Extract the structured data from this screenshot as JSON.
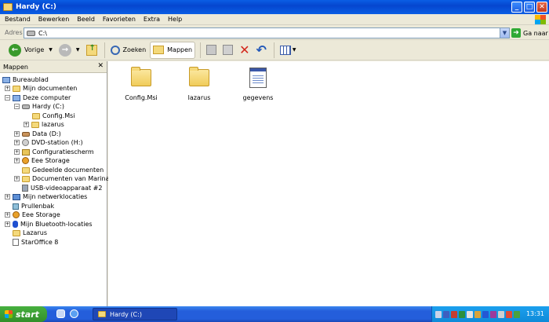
{
  "window": {
    "title": "Hardy (C:)",
    "controls": {
      "minimize": "_",
      "maximize": "□",
      "close": "✕"
    }
  },
  "menu": [
    "Bestand",
    "Bewerken",
    "Beeld",
    "Favorieten",
    "Extra",
    "Help"
  ],
  "address": {
    "label": "Adres",
    "value": "C:\\",
    "go_label": "Ga naar"
  },
  "toolbar": {
    "back_label": "Vorige",
    "search_label": "Zoeken",
    "folders_label": "Mappen"
  },
  "sidebar": {
    "title": "Mappen",
    "close_glyph": "✕",
    "items": [
      {
        "label": "Bureaublad",
        "icon": "desktop-icon",
        "expander": ""
      },
      {
        "label": "Mijn documenten",
        "icon": "folder-icon",
        "expander": "+"
      },
      {
        "label": "Deze computer",
        "icon": "computer-icon",
        "expander": "−"
      },
      {
        "label": "Hardy (C:)",
        "icon": "drive-icon",
        "expander": "−"
      },
      {
        "label": "Config.Msi",
        "icon": "folder-icon",
        "expander": ""
      },
      {
        "label": "lazarus",
        "icon": "folder-icon",
        "expander": "+"
      },
      {
        "label": "Data (D:)",
        "icon": "drive-icon",
        "expander": "+"
      },
      {
        "label": "DVD-station (H:)",
        "icon": "dvd-icon",
        "expander": "+"
      },
      {
        "label": "Configuratiescherm",
        "icon": "control-panel-icon",
        "expander": "+"
      },
      {
        "label": "Eee Storage",
        "icon": "globe-icon",
        "expander": "+"
      },
      {
        "label": "Gedeelde documenten",
        "icon": "folder-icon",
        "expander": ""
      },
      {
        "label": "Documenten van Marina",
        "icon": "folder-icon",
        "expander": "+"
      },
      {
        "label": "USB-videoapparaat #2",
        "icon": "camera-icon",
        "expander": ""
      },
      {
        "label": "Mijn netwerklocaties",
        "icon": "network-icon",
        "expander": "+"
      },
      {
        "label": "Prullenbak",
        "icon": "recycle-bin-icon",
        "expander": ""
      },
      {
        "label": "Eee Storage",
        "icon": "globe-icon",
        "expander": "+"
      },
      {
        "label": "Mijn Bluetooth-locaties",
        "icon": "bluetooth-icon",
        "expander": "+"
      },
      {
        "label": "Lazarus",
        "icon": "folder-icon",
        "expander": ""
      },
      {
        "label": "StarOffice 8",
        "icon": "document-icon",
        "expander": ""
      }
    ]
  },
  "files": [
    {
      "name": "Config.Msi",
      "icon": "folder-icon"
    },
    {
      "name": "lazarus",
      "icon": "folder-icon"
    },
    {
      "name": "gegevens",
      "icon": "document-icon"
    }
  ],
  "taskbar": {
    "start_label": "start",
    "task_label": "Hardy (C:)",
    "clock": "13:31"
  }
}
